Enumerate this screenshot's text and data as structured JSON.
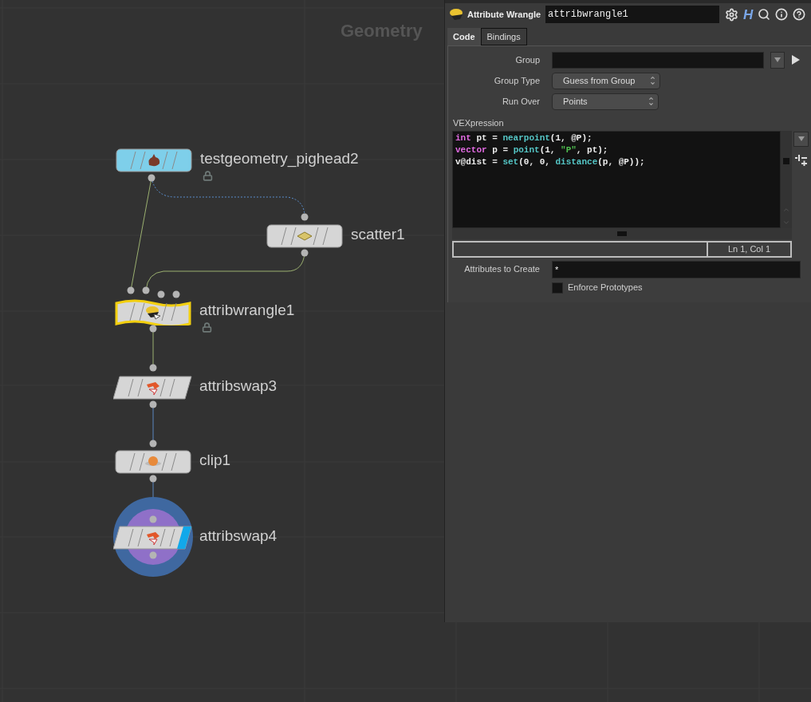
{
  "network": {
    "title": "Geometry",
    "nodes": [
      {
        "name": "testgeometry_pighead2",
        "kind": "rect",
        "color": "#7ecfea",
        "locked": true,
        "selected": false,
        "display": false
      },
      {
        "name": "scatter1",
        "kind": "rect",
        "color": "#d6d6d6",
        "locked": false,
        "selected": false,
        "display": false
      },
      {
        "name": "attribwrangle1",
        "kind": "wave",
        "color": "#d6d6d6",
        "locked": true,
        "selected": true,
        "display": false
      },
      {
        "name": "attribswap3",
        "kind": "slant",
        "color": "#d6d6d6",
        "locked": false,
        "selected": false,
        "display": false
      },
      {
        "name": "clip1",
        "kind": "rect",
        "color": "#d6d6d6",
        "locked": false,
        "selected": false,
        "display": false
      },
      {
        "name": "attribswap4",
        "kind": "slant",
        "color": "#d6d6d6",
        "locked": false,
        "selected": false,
        "display": true
      }
    ]
  },
  "panel": {
    "type_label": "Attribute Wrangle",
    "node_name": "attribwrangle1",
    "logo_button": "H",
    "tabs": [
      {
        "label": "Code",
        "selected": true
      },
      {
        "label": "Bindings",
        "selected": false
      }
    ],
    "params": [
      {
        "kind": "field",
        "label": "Group"
      },
      {
        "kind": "menu",
        "label": "Group Type",
        "value": "Guess from Group"
      },
      {
        "kind": "menu",
        "label": "Run Over",
        "value": "Points"
      }
    ],
    "vex_label": "VEXpression",
    "code": [
      [
        {
          "t": "int",
          "kind": "keyword"
        },
        {
          "t": " pt = ",
          "kind": "plain"
        },
        {
          "t": "nearpoint",
          "kind": "function"
        },
        {
          "t": "(1, @P);",
          "kind": "plain"
        }
      ],
      [
        {
          "t": "vector",
          "kind": "keyword"
        },
        {
          "t": " p = ",
          "kind": "plain"
        },
        {
          "t": "point",
          "kind": "function"
        },
        {
          "t": "(1, ",
          "kind": "plain"
        },
        {
          "t": "\"P\"",
          "kind": "string"
        },
        {
          "t": ", pt);",
          "kind": "plain"
        }
      ],
      [
        {
          "t": "v@dist = ",
          "kind": "plain"
        },
        {
          "t": "set",
          "kind": "function"
        },
        {
          "t": "(0, 0, ",
          "kind": "plain"
        },
        {
          "t": "distance",
          "kind": "function"
        },
        {
          "t": "(p, @P));",
          "kind": "plain"
        }
      ]
    ],
    "cursor_position": "Ln 1, Col 1",
    "attributes_label": "Attributes to Create",
    "attributes_value": "*",
    "enforce": {
      "label": "Enforce Prototypes",
      "checked": false
    }
  }
}
